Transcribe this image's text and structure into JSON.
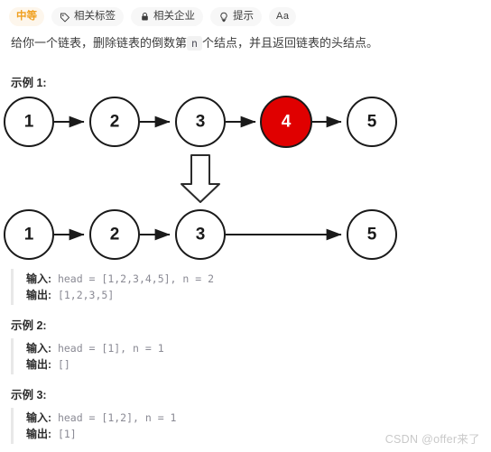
{
  "tags": [
    {
      "label": "中等",
      "icon": "difficulty-badge",
      "style": "difficulty"
    },
    {
      "label": "相关标签",
      "icon": "tag-icon",
      "style": "normal"
    },
    {
      "label": "相关企业",
      "icon": "lock-icon",
      "style": "normal"
    },
    {
      "label": "提示",
      "icon": "lightbulb-icon",
      "style": "normal"
    },
    {
      "label": "Aa",
      "icon": "font-size-icon",
      "style": "aa"
    }
  ],
  "description": {
    "before": "给你一个链表，删除链表的倒数第",
    "code": "n",
    "after": "个结点，并且返回链表的头结点。"
  },
  "examples": [
    {
      "title": "示例 1:",
      "input_label": "输入:",
      "input_value": "head = [1,2,3,4,5], n = 2",
      "output_label": "输出:",
      "output_value": "[1,2,3,5]"
    },
    {
      "title": "示例 2:",
      "input_label": "输入:",
      "input_value": "head = [1], n = 1",
      "output_label": "输出:",
      "output_value": "[]"
    },
    {
      "title": "示例 3:",
      "input_label": "输入:",
      "input_value": "head = [1,2], n = 1",
      "output_label": "输出:",
      "output_value": "[1]"
    }
  ],
  "diagram": {
    "before_nodes": [
      "1",
      "2",
      "3",
      "4",
      "5"
    ],
    "highlight_node": "4",
    "after_nodes": [
      "1",
      "2",
      "3",
      "5"
    ],
    "highlight_color": "#e00000",
    "node_border_color": "#1a1a1a",
    "node_fill_color": "#ffffff",
    "arrow_color": "#1a1a1a",
    "down_arrow": "transform-arrow-down"
  },
  "watermark": "CSDN @offer来了"
}
